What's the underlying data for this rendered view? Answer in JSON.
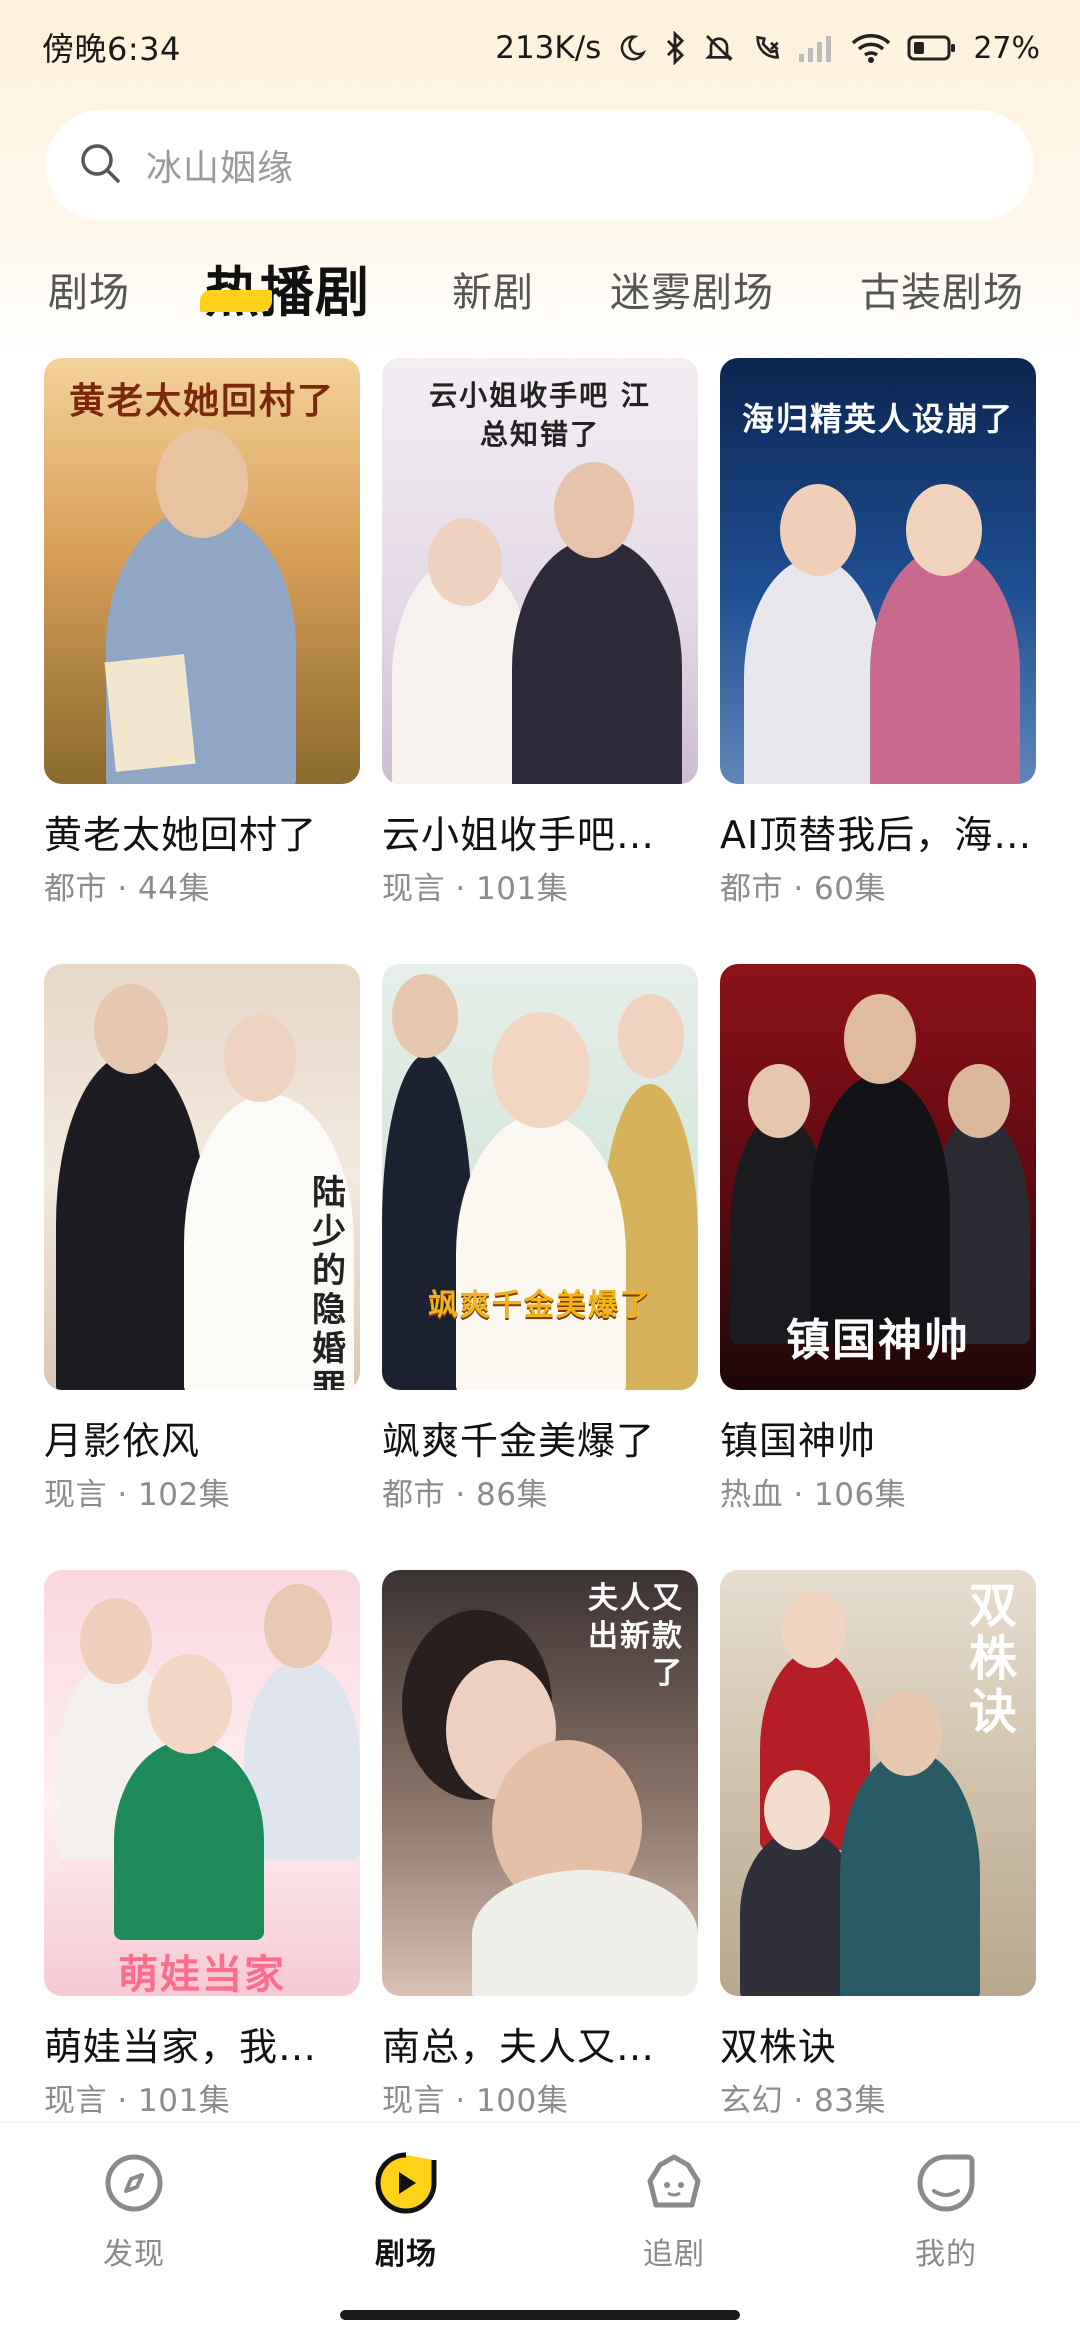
{
  "status_bar": {
    "time": "傍晚6:34",
    "net_speed": "213K/s",
    "battery": "27%",
    "icons": [
      "moon-icon",
      "bluetooth-icon",
      "mute-icon",
      "call-icon",
      "signal-icon",
      "wifi-icon",
      "battery-icon"
    ]
  },
  "search": {
    "placeholder": "冰山姻缘"
  },
  "tabs": [
    {
      "label": "剧场",
      "active": false
    },
    {
      "label": "热播剧",
      "active": true
    },
    {
      "label": "新剧",
      "active": false
    },
    {
      "label": "迷雾剧场",
      "active": false
    },
    {
      "label": "古装剧场",
      "active": false
    }
  ],
  "dramas": [
    {
      "title": "黄老太她回村了",
      "meta": "都市 · 44集",
      "poster_text": "黄老太她回村了",
      "colors": [
        "#c98a3a",
        "#f0c27a"
      ]
    },
    {
      "title": "云小姐收手吧…",
      "meta": "现言 · 101集",
      "poster_text": "云小姐收手吧 江总知错了",
      "colors": [
        "#ece4ee",
        "#f7f2f6"
      ]
    },
    {
      "title": "AI顶替我后，海…",
      "meta": "都市 · 60集",
      "poster_text": "海归精英人设崩了",
      "colors": [
        "#0e2c5c",
        "#3a6fb0"
      ]
    },
    {
      "title": "月影依风",
      "meta": "现言 · 102集",
      "poster_text": "陆少的隐婚罪妻",
      "colors": [
        "#e9ddd0",
        "#f6efe7"
      ]
    },
    {
      "title": "飒爽千金美爆了",
      "meta": "都市 · 86集",
      "poster_text": "飒爽千金美爆了",
      "colors": [
        "#e9f1ec",
        "#c8dfd4"
      ]
    },
    {
      "title": "镇国神帅",
      "meta": "热血 · 106集",
      "poster_text": "镇国神帅",
      "colors": [
        "#7a0d12",
        "#2a0a0c"
      ]
    },
    {
      "title": "萌娃当家，我…",
      "meta": "现言 · 101集",
      "poster_text": "萌娃当家",
      "colors": [
        "#f9dde3",
        "#ffeef2"
      ]
    },
    {
      "title": "南总，夫人又…",
      "meta": "现言 · 100集",
      "poster_text": "夫人又出新款了",
      "colors": [
        "#5a4a4a",
        "#b79d8f"
      ]
    },
    {
      "title": "双株诀",
      "meta": "玄幻 · 83集",
      "poster_text": "双株诀",
      "colors": [
        "#d9d0c2",
        "#8a1e22"
      ]
    }
  ],
  "bottom_nav": [
    {
      "label": "发现",
      "icon": "compass-icon",
      "active": false
    },
    {
      "label": "剧场",
      "icon": "play-icon",
      "active": true
    },
    {
      "label": "追剧",
      "icon": "follow-icon",
      "active": false
    },
    {
      "label": "我的",
      "icon": "profile-icon",
      "active": false
    }
  ]
}
